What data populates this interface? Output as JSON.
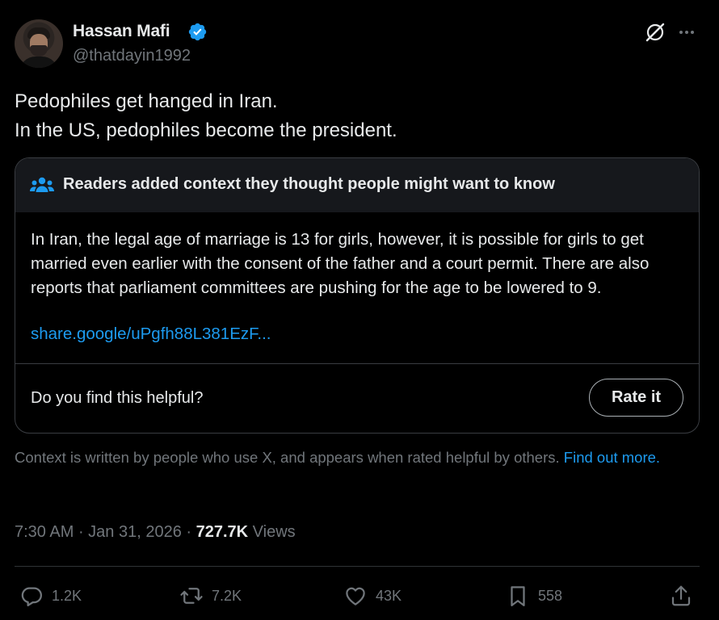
{
  "author": {
    "display_name": "Hassan Mafi",
    "handle": "@thatdayin1992",
    "verified": true
  },
  "tweet": {
    "text": "Pedophiles get hanged in Iran.\nIn the US, pedophiles become the president."
  },
  "community_note": {
    "title": "Readers added context they thought people might want to know",
    "body": "In Iran, the legal age of marriage is 13 for girls, however, it is possible for girls to get married even earlier with the consent of the father and a court permit. There are also reports that parliament committees are pushing for the age to be lowered to 9.",
    "link": "share.google/uPgfh88L381EzF...",
    "helpful_prompt": "Do you find this helpful?",
    "rate_label": "Rate it"
  },
  "context_footer": {
    "text": "Context is written by people who use X, and appears when rated helpful by others.",
    "link_label": "Find out more."
  },
  "meta": {
    "time": "7:30 AM",
    "date": "Jan 31, 2026",
    "views_count": "727.7K",
    "views_label": "Views"
  },
  "actions": {
    "replies": "1.2K",
    "reposts": "7.2K",
    "likes": "43K",
    "bookmarks": "558"
  },
  "colors": {
    "background": "#000000",
    "text_primary": "#e7e9ea",
    "text_secondary": "#71767b",
    "accent_blue": "#1d9bf0",
    "note_header_bg": "#16181c",
    "border": "#3a3d42"
  },
  "icons": [
    "verified-badge-icon",
    "grok-icon",
    "more-icon",
    "people-icon",
    "reply-icon",
    "repost-icon",
    "like-icon",
    "bookmark-icon",
    "share-icon"
  ]
}
